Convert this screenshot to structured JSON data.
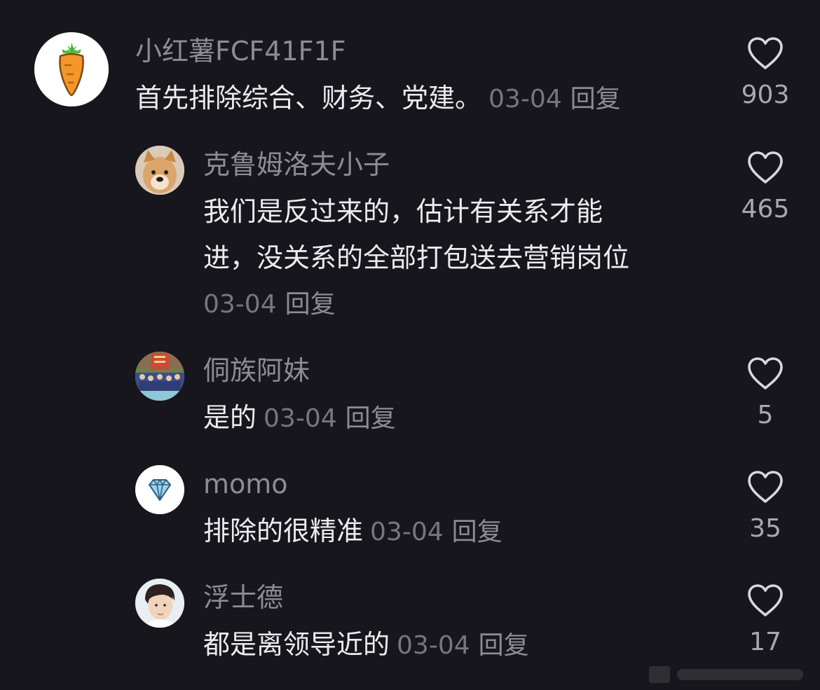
{
  "comments": [
    {
      "username": "小红薯FCF41F1F",
      "avatar": "carrot-icon",
      "lines": [
        "首先排除综合、财务、党建。"
      ],
      "date": "03-04",
      "reply_label": "回复",
      "likes": "903"
    },
    {
      "username": "克鲁姆洛夫小子",
      "avatar": "dog-avatar",
      "lines": [
        "我们是反过来的，估计有关系才能",
        "进，没关系的全部打包送去营销岗位"
      ],
      "date": "03-04",
      "reply_label": "回复",
      "likes": "465"
    },
    {
      "username": "侗族阿妹",
      "avatar": "group-photo-avatar",
      "lines": [
        "是的"
      ],
      "date": "03-04",
      "reply_label": "回复",
      "likes": "5"
    },
    {
      "username": "momo",
      "avatar": "diamond-icon",
      "lines": [
        "排除的很精准"
      ],
      "date": "03-04",
      "reply_label": "回复",
      "likes": "35"
    },
    {
      "username": "浮士德",
      "avatar": "portrait-avatar",
      "lines": [
        "都是离领导近的"
      ],
      "date": "03-04",
      "reply_label": "回复",
      "likes": "17"
    }
  ],
  "colors": {
    "background": "#17161c",
    "username": "#8d8c93",
    "text": "#ececef",
    "meta": "#77767d",
    "like_icon": "#d8d8dc"
  }
}
